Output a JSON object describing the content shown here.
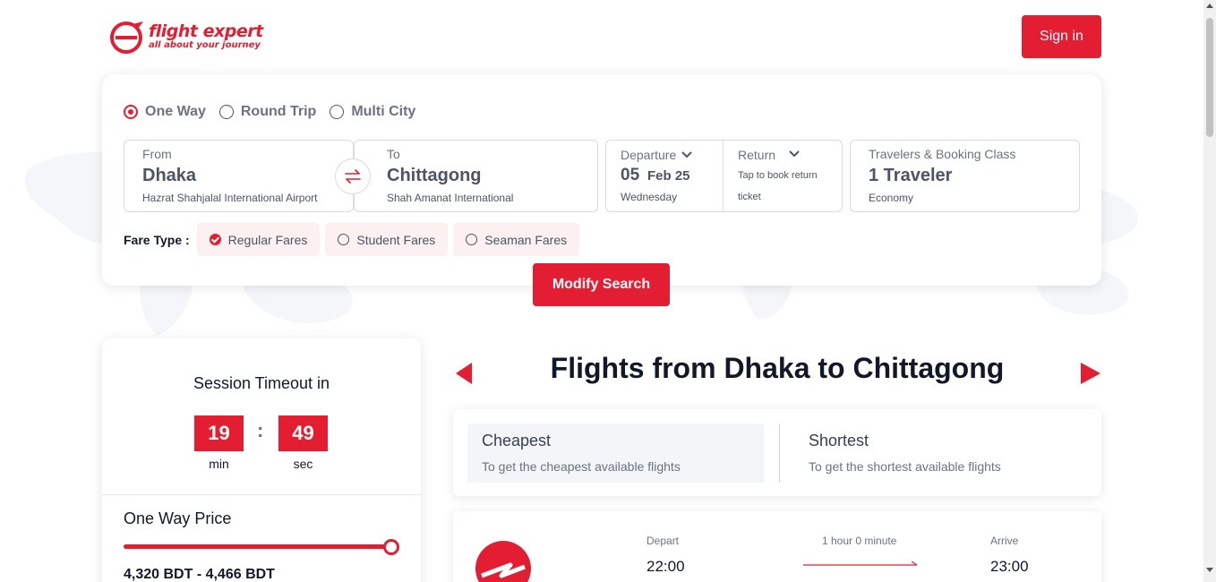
{
  "brand": {
    "name": "flight expert",
    "tagline": "all about your journey",
    "accent_color": "#e41e32"
  },
  "header": {
    "signin_label": "Sign in"
  },
  "search": {
    "trip_types": [
      {
        "label": "One Way",
        "selected": true
      },
      {
        "label": "Round Trip",
        "selected": false
      },
      {
        "label": "Multi City",
        "selected": false
      }
    ],
    "from": {
      "label": "From",
      "city": "Dhaka",
      "airport": "Hazrat Shahjalal International Airport"
    },
    "to": {
      "label": "To",
      "city": "Chittagong",
      "airport": "Shah Amanat International"
    },
    "departure": {
      "label": "Departure",
      "day": "05",
      "month_year": "Feb 25",
      "weekday": "Wednesday"
    },
    "return": {
      "label": "Return",
      "hint_line1": "Tap to book return",
      "hint_line2": "ticket"
    },
    "travelers": {
      "label": "Travelers & Booking Class",
      "count": "1 Traveler",
      "class": "Economy"
    },
    "fare_type_label": "Fare Type :",
    "fare_types": [
      {
        "label": "Regular Fares",
        "selected": true
      },
      {
        "label": "Student Fares",
        "selected": false
      },
      {
        "label": "Seaman Fares",
        "selected": false
      }
    ],
    "modify_label": "Modify Search"
  },
  "session": {
    "title": "Session Timeout in",
    "minutes": "19",
    "seconds": "49",
    "min_label": "min",
    "sec_label": "sec"
  },
  "price_filter": {
    "title": "One Way Price",
    "range_text": "4,320 BDT - 4,466 BDT",
    "slider_fill_fraction": 1.0
  },
  "results": {
    "title_prefix": "Flights from",
    "origin": "Dhaka",
    "connector": "to",
    "destination": "Chittagong"
  },
  "sort": {
    "options": [
      {
        "title": "Cheapest",
        "desc": "To get the cheapest available flights",
        "active": true
      },
      {
        "title": "Shortest",
        "desc": "To get the shortest available flights",
        "active": false
      }
    ]
  },
  "flight": {
    "depart_label": "Depart",
    "depart_time": "22:00",
    "duration": "1 hour 0 minute",
    "arrive_label": "Arrive",
    "arrive_time": "23:00"
  }
}
